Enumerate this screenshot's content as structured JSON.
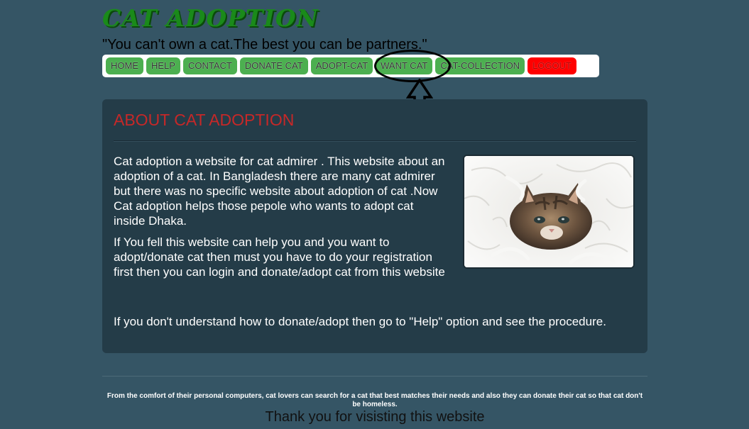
{
  "header": {
    "site_title": "CAT ADOPTION",
    "tagline": "\"You can't own a cat.The best you can be partners.\""
  },
  "nav": {
    "items": [
      {
        "label": "HOME"
      },
      {
        "label": "HELP"
      },
      {
        "label": "CONTACT"
      },
      {
        "label": "DONATE CAT"
      },
      {
        "label": "ADOPT-CAT"
      },
      {
        "label": "WANT CAT"
      },
      {
        "label": "CAT-COLLECTION"
      },
      {
        "label": "LOGOUT"
      }
    ]
  },
  "main": {
    "heading": "ABOUT CAT ADOPTION",
    "paragraph1": "Cat adoption a website for cat admirer . This website about an adoption of a cat. In Bangladesh there are many cat admirer but there was no specific website about adoption of cat .Now Cat adoption helps those pepole who wants to adopt cat inside Dhaka.",
    "paragraph2": "If You fell this website can help you and you want to adopt/donate cat then must you have to do your registration first then you can login and donate/adopt cat from this website",
    "paragraph3": "If you don't understand how to donate/adopt then go to \"Help\" option and see the procedure."
  },
  "footer": {
    "description": "From the comfort of their personal computers, cat lovers can search for a cat that best matches their needs and also they can donate their cat so that cat don't be homeless.",
    "thanks": "Thank you for visisting this website"
  },
  "colors": {
    "background": "#355565",
    "panel": "#243c48",
    "heading": "#c62828",
    "nav_button": "#4caf50",
    "logout_button": "#ff0000",
    "title": "#1a8a1a"
  },
  "annotations": {
    "highlight": "ellipse around want-cat nav button",
    "arrow": "up-arrow-icon"
  }
}
